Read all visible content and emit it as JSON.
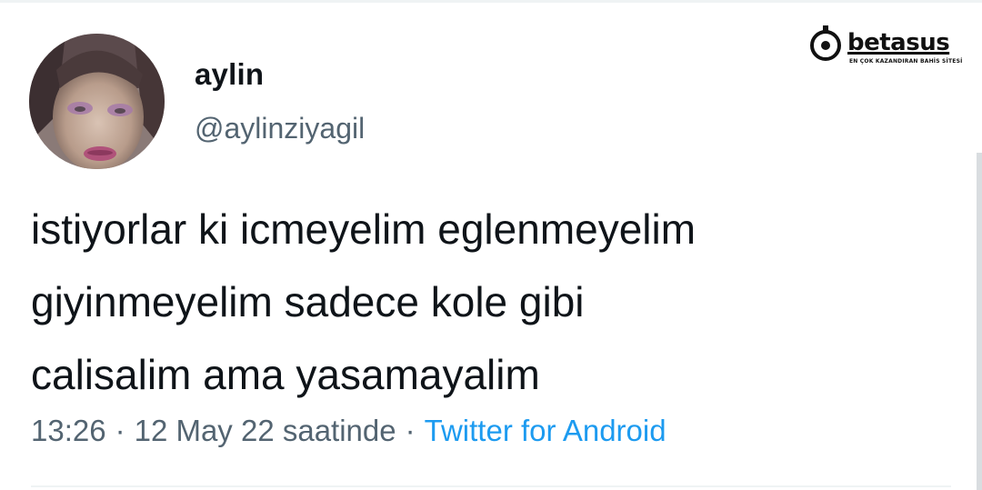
{
  "tweet": {
    "display_name": "aylin",
    "handle": "@aylinziyagil",
    "text_lines": [
      "istiyorlar ki icmeyelim eglenmeyelim",
      "giyinmeyelim sadece kole gibi",
      "calisalim ama yasamayalim"
    ],
    "time": "13:26",
    "date": "12 May 22 saatinde",
    "separator": "·",
    "source": "Twitter for Android"
  },
  "watermark": {
    "name": "betasus",
    "slogan": "EN ÇOK KAZANDIRAN BAHİS SİTESİ"
  },
  "colors": {
    "text": "#0f1419",
    "secondary": "#536471",
    "link": "#1d9bf0"
  }
}
